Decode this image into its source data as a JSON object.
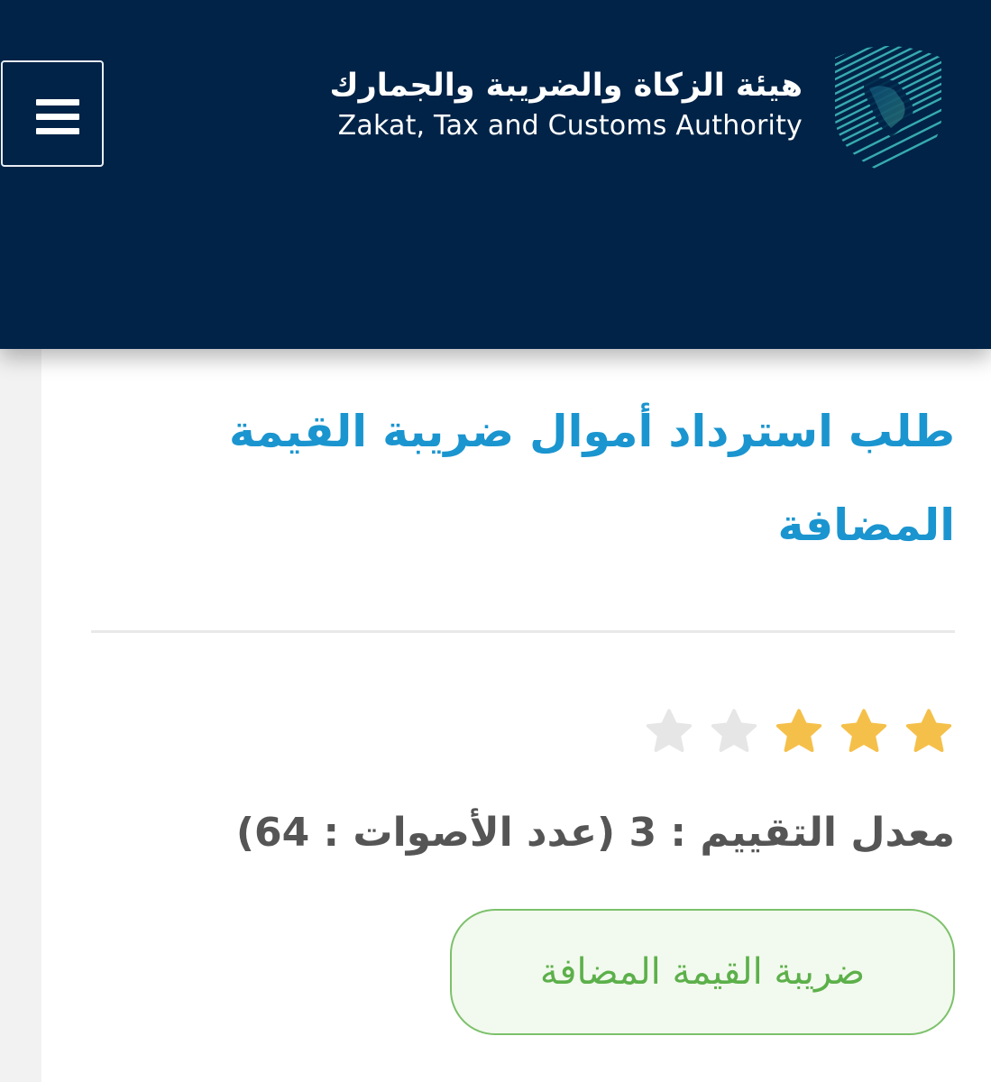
{
  "header": {
    "org_name_ar": "هيئة الزكاة والضريبة والجمارك",
    "org_name_en": "Zakat, Tax and Customs Authority",
    "logo_icon": "zatca-shield-logo",
    "menu_icon": "hamburger-menu-icon",
    "background_color": "#002347"
  },
  "service": {
    "title": "طلب استرداد أموال ضريبة القيمة المضافة",
    "rating": {
      "average": 3,
      "max": 5,
      "votes": 64,
      "text": "معدل التقييم : 3 (عدد الأصوات : 64)",
      "filled_color": "#f5c04a",
      "empty_color": "#e6e6e6"
    },
    "category_tag": "ضريبة القيمة المضافة"
  },
  "colors": {
    "title": "#1b95cf",
    "tag_text": "#5cb04a",
    "tag_border": "#7cc16b"
  }
}
